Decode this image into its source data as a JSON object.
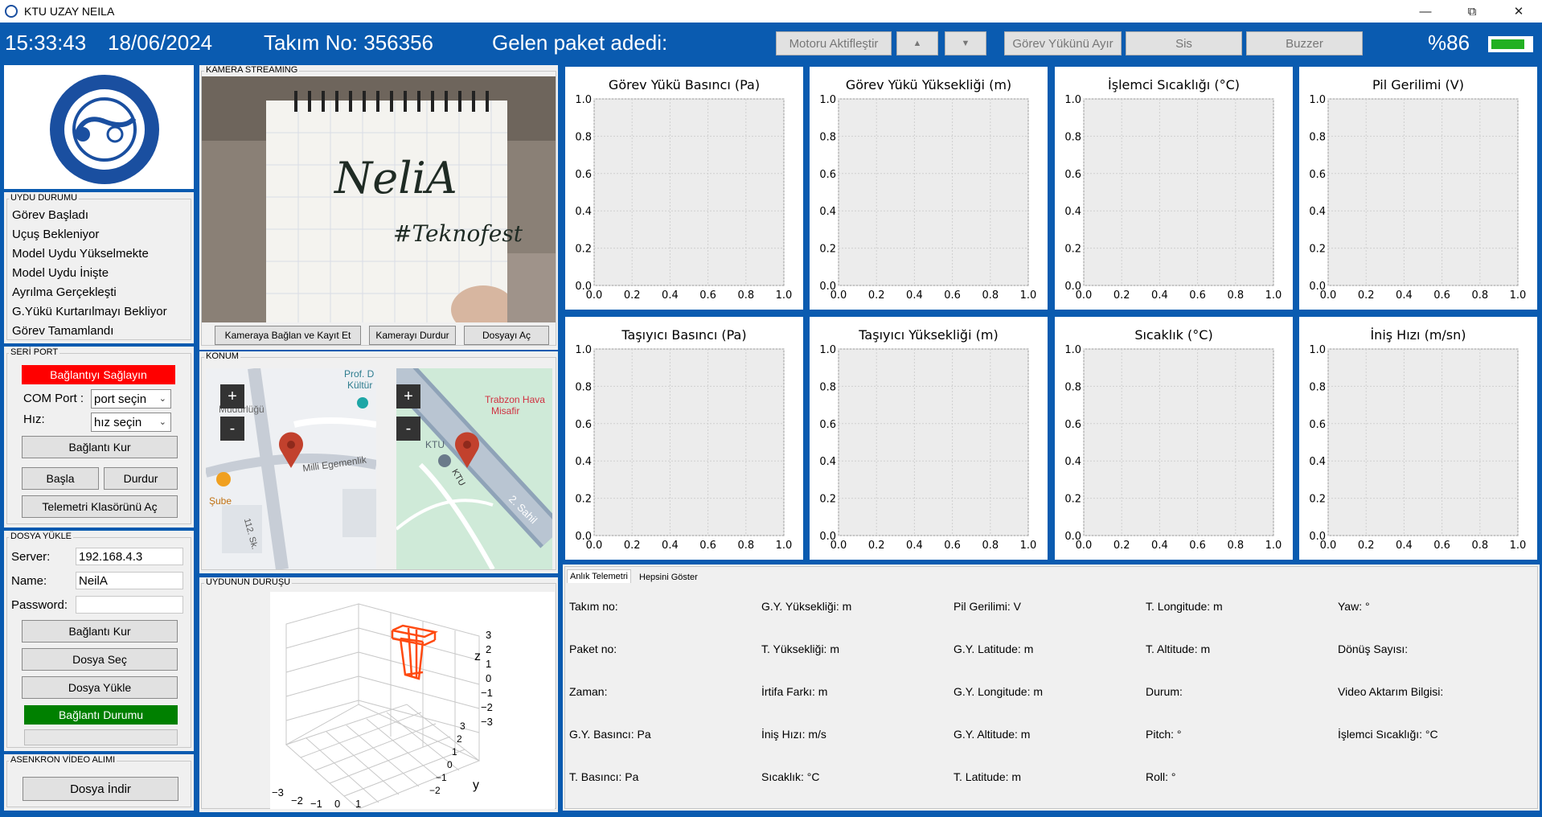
{
  "window": {
    "title": "KTU UZAY NEILA"
  },
  "topbar": {
    "time": "15:33:43",
    "date": "18/06/2024",
    "team": "Takım No: 356356",
    "packets": "Gelen paket adedi:",
    "motor_btn": "Motoru Aktifleştir",
    "up_btn": "▲",
    "down_btn": "▼",
    "separate_btn": "Görev Yükünü Ayır",
    "sis_btn": "Sis",
    "buzzer_btn": "Buzzer",
    "battery_text": "%86",
    "battery_level": 0.86,
    "colors": {
      "accent": "#0a5bb0",
      "battery": "#22b022"
    }
  },
  "status": {
    "title": "UYDU DURUMU",
    "items": [
      "Görev Başladı",
      "Uçuş Bekleniyor",
      "Model Uydu Yükselmekte",
      "Model Uydu İnişte",
      "Ayrılma Gerçekleşti",
      "G.Yükü Kurtarılmayı Bekliyor",
      "Görev Tamamlandı"
    ]
  },
  "serial": {
    "title": "SERİ PORT",
    "connect_status": "Bağlantıyı Sağlayın",
    "com_label": "COM Port :",
    "com_value": "port seçin",
    "speed_label": "Hız:",
    "speed_value": "hız seçin",
    "connect_btn": "Bağlantı Kur",
    "start_btn": "Başla",
    "stop_btn": "Durdur",
    "folder_btn": "Telemetri Klasörünü Aç",
    "colors": {
      "status": "#ff0000"
    }
  },
  "upload": {
    "title": "DOSYA YÜKLE",
    "server_label": "Server:",
    "server_value": "192.168.4.3",
    "name_label": "Name:",
    "name_value": "NeilA",
    "password_label": "Password:",
    "connect_btn": "Bağlantı Kur",
    "select_btn": "Dosya Seç",
    "upload_btn": "Dosya Yükle",
    "status": "Bağlantı Durumu",
    "colors": {
      "status": "#008000"
    }
  },
  "async": {
    "title": "ASENKRON VİDEO ALIMI",
    "download_btn": "Dosya İndir"
  },
  "camera": {
    "title": "KAMERA STREAMING",
    "connect_btn": "Kameraya Bağlan ve Kayıt Et",
    "stop_btn": "Kamerayı Durdur",
    "open_btn": "Dosyayı Aç",
    "notebook_text": "NeliA",
    "notebook_tag": "#Teknofest"
  },
  "map": {
    "title": "KONUM",
    "zoom_in": "+",
    "zoom_out": "-",
    "left_labels": [
      "Prof. D",
      "Kültür",
      "Müdürlüğü",
      "Milli Egemenlik",
      "Şube",
      "112. Sk."
    ],
    "right_labels": [
      "Trabzon Hava",
      "Misafir",
      "KTU",
      "KTU",
      "2. Sahil"
    ]
  },
  "attitude": {
    "title": "UYDUNUN DURUŞU",
    "z_label": "z",
    "y_label": "y",
    "z_ticks": [
      "3",
      "2",
      "1",
      "0",
      "−1",
      "−2",
      "−3"
    ],
    "x_ticks": [
      "−3",
      "−2",
      "−1",
      "0",
      "1"
    ],
    "y_ticks": [
      "3",
      "2",
      "1",
      "0",
      "−1",
      "−2"
    ]
  },
  "charts": [
    {
      "title": "Görev Yükü Basıncı (Pa)"
    },
    {
      "title": "Görev Yükü Yüksekliği (m)"
    },
    {
      "title": "İşlemci Sıcaklığı (°C)"
    },
    {
      "title": "Pil Gerilimi (V)"
    },
    {
      "title": "Taşıyıcı Basıncı (Pa)"
    },
    {
      "title": "Taşıyıcı Yüksekliği (m)"
    },
    {
      "title": "Sıcaklık (°C)"
    },
    {
      "title": "İniş Hızı (m/sn)"
    }
  ],
  "chart_data": [
    {
      "type": "line",
      "title": "Görev Yükü Basıncı (Pa)",
      "xlim": [
        0,
        1
      ],
      "ylim": [
        0,
        1
      ],
      "xticks": [
        "0.0",
        "0.2",
        "0.4",
        "0.6",
        "0.8",
        "1.0"
      ],
      "yticks": [
        "0.0",
        "0.2",
        "0.4",
        "0.6",
        "0.8",
        "1.0"
      ],
      "series": [],
      "grid": true
    },
    {
      "type": "line",
      "title": "Görev Yükü Yüksekliği (m)",
      "xlim": [
        0,
        1
      ],
      "ylim": [
        0,
        1
      ],
      "xticks": [
        "0.0",
        "0.2",
        "0.4",
        "0.6",
        "0.8",
        "1.0"
      ],
      "yticks": [
        "0.0",
        "0.2",
        "0.4",
        "0.6",
        "0.8",
        "1.0"
      ],
      "series": [],
      "grid": true
    },
    {
      "type": "line",
      "title": "İşlemci Sıcaklığı (°C)",
      "xlim": [
        0,
        1
      ],
      "ylim": [
        0,
        1
      ],
      "xticks": [
        "0.0",
        "0.2",
        "0.4",
        "0.6",
        "0.8",
        "1.0"
      ],
      "yticks": [
        "0.0",
        "0.2",
        "0.4",
        "0.6",
        "0.8",
        "1.0"
      ],
      "series": [],
      "grid": true
    },
    {
      "type": "line",
      "title": "Pil Gerilimi (V)",
      "xlim": [
        0,
        1
      ],
      "ylim": [
        0,
        1
      ],
      "xticks": [
        "0.0",
        "0.2",
        "0.4",
        "0.6",
        "0.8",
        "1.0"
      ],
      "yticks": [
        "0.0",
        "0.2",
        "0.4",
        "0.6",
        "0.8",
        "1.0"
      ],
      "series": [],
      "grid": true
    },
    {
      "type": "line",
      "title": "Taşıyıcı Basıncı (Pa)",
      "xlim": [
        0,
        1
      ],
      "ylim": [
        0,
        1
      ],
      "xticks": [
        "0.0",
        "0.2",
        "0.4",
        "0.6",
        "0.8",
        "1.0"
      ],
      "yticks": [
        "0.0",
        "0.2",
        "0.4",
        "0.6",
        "0.8",
        "1.0"
      ],
      "series": [],
      "grid": true
    },
    {
      "type": "line",
      "title": "Taşıyıcı Yüksekliği (m)",
      "xlim": [
        0,
        1
      ],
      "ylim": [
        0,
        1
      ],
      "xticks": [
        "0.0",
        "0.2",
        "0.4",
        "0.6",
        "0.8",
        "1.0"
      ],
      "yticks": [
        "0.0",
        "0.2",
        "0.4",
        "0.6",
        "0.8",
        "1.0"
      ],
      "series": [],
      "grid": true
    },
    {
      "type": "line",
      "title": "Sıcaklık (°C)",
      "xlim": [
        0,
        1
      ],
      "ylim": [
        0,
        1
      ],
      "xticks": [
        "0.0",
        "0.2",
        "0.4",
        "0.6",
        "0.8",
        "1.0"
      ],
      "yticks": [
        "0.0",
        "0.2",
        "0.4",
        "0.6",
        "0.8",
        "1.0"
      ],
      "series": [],
      "grid": true
    },
    {
      "type": "line",
      "title": "İniş Hızı (m/sn)",
      "xlim": [
        0,
        1
      ],
      "ylim": [
        0,
        1
      ],
      "xticks": [
        "0.0",
        "0.2",
        "0.4",
        "0.6",
        "0.8",
        "1.0"
      ],
      "yticks": [
        "0.0",
        "0.2",
        "0.4",
        "0.6",
        "0.8",
        "1.0"
      ],
      "series": [],
      "grid": true
    }
  ],
  "telemetry": {
    "tabs": [
      "Anlık Telemetri",
      "Hepsini Göster"
    ],
    "rows": [
      [
        "Takım no:",
        "G.Y. Yüksekliği:  m",
        "Pil Gerilimi:  V",
        "T. Longitude:  m",
        "Yaw: °"
      ],
      [
        "Paket no:",
        "T. Yüksekliği:  m",
        "G.Y. Latitude:  m",
        "T. Altitude:  m",
        "Dönüş Sayısı:"
      ],
      [
        "Zaman:",
        "İrtifa Farkı:  m",
        "G.Y. Longitude:  m",
        "Durum:",
        "Video Aktarım Bilgisi:"
      ],
      [
        "G.Y. Basıncı:  Pa",
        "İniş Hızı:  m/s",
        "G.Y. Altitude:  m",
        "Pitch: °",
        "İşlemci Sıcaklığı:  °C"
      ],
      [
        "T. Basıncı:  Pa",
        "Sıcaklık:  °C",
        "T. Latitude:  m",
        "Roll: °",
        ""
      ]
    ]
  }
}
